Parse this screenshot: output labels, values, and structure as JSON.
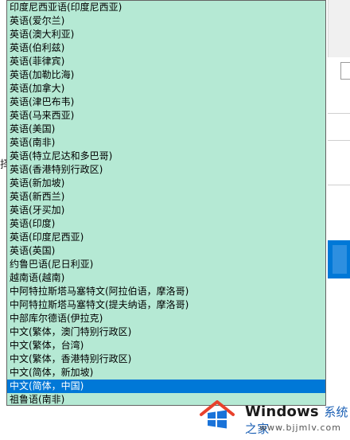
{
  "background": {
    "side_field_text": "",
    "left_label_fragment": "择"
  },
  "dropdown": {
    "selected_index": 28,
    "items": [
      "印度尼西亚语(印度尼西亚)",
      "英语(爱尔兰)",
      "英语(澳大利亚)",
      "英语(伯利兹)",
      "英语(菲律宾)",
      "英语(加勒比海)",
      "英语(加拿大)",
      "英语(津巴布韦)",
      "英语(马来西亚)",
      "英语(美国)",
      "英语(南非)",
      "英语(特立尼达和多巴哥)",
      "英语(香港特别行政区)",
      "英语(新加坡)",
      "英语(新西兰)",
      "英语(牙买加)",
      "英语(印度)",
      "英语(印度尼西亚)",
      "英语(英国)",
      "约鲁巴语(尼日利亚)",
      "越南语(越南)",
      "中阿特拉斯塔马塞特文(阿拉伯语，摩洛哥)",
      "中阿特拉斯塔马塞特文(提夫纳语，摩洛哥)",
      "中部库尔德语(伊拉克)",
      "中文(繁体，澳门特别行政区)",
      "中文(繁体，台湾)",
      "中文(繁体，香港特别行政区)",
      "中文(简体，新加坡)",
      "中文(简体，中国)",
      "祖鲁语(南非)"
    ],
    "scroll_position": 0.9
  },
  "watermark": {
    "brand": "Windows",
    "brand_suffix": "系统之家",
    "url": "www.bjjmlv.com"
  },
  "colors": {
    "list_background": "#b5e9d4",
    "selection": "#0078d7",
    "logo_red": "#e8412c",
    "logo_blue": "#1a73d9"
  }
}
